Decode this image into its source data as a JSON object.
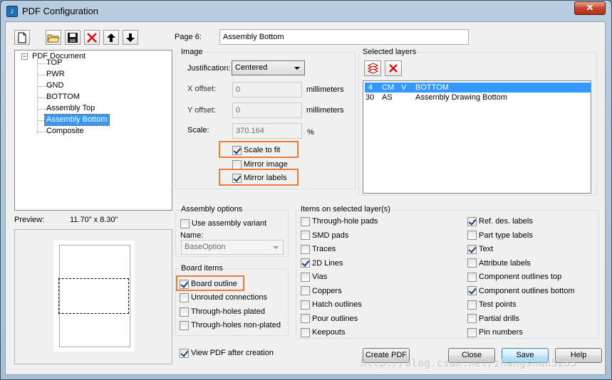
{
  "window": {
    "title": "PDF Configuration",
    "close_glyph": "✕"
  },
  "toolbar": {
    "buttons": [
      {
        "name": "new-icon"
      },
      {
        "name": "open-folder-icon"
      },
      {
        "name": "save-icon"
      },
      {
        "name": "delete-icon"
      },
      {
        "name": "move-up-icon"
      },
      {
        "name": "move-down-icon"
      }
    ]
  },
  "tree": {
    "root": "PDF Document",
    "expander": "−",
    "items": [
      "TOP",
      "PWR",
      "GND",
      "BOTTOM",
      "Assembly Top",
      "Assembly Bottom",
      "Composite"
    ],
    "selected_index": 5
  },
  "page": {
    "label": "Page 6:",
    "value": "Assembly Bottom"
  },
  "image": {
    "group_label": "Image",
    "justification_label": "Justification:",
    "justification_value": "Centered",
    "x_offset_label": "X offset:",
    "x_offset_value": "0",
    "y_offset_label": "Y offset:",
    "y_offset_value": "0",
    "scale_label": "Scale:",
    "scale_value": "370.164",
    "unit_mm": "millimeters",
    "unit_pct": "%",
    "scale_to_fit": {
      "label": "Scale to fit",
      "checked": true
    },
    "mirror_image": {
      "label": "Mirror image",
      "checked": false
    },
    "mirror_labels": {
      "label": "Mirror labels",
      "checked": true
    }
  },
  "selected_layers": {
    "group_label": "Selected layers",
    "rows": [
      {
        "num": "4",
        "type": "CM",
        "flag": "V",
        "name": "BOTTOM"
      },
      {
        "num": "30",
        "type": "AS",
        "flag": "",
        "name": "Assembly Drawing Bottom"
      }
    ],
    "selected_index": 0
  },
  "preview": {
    "label": "Preview:",
    "size": "11.70\" x  8.30\""
  },
  "assembly_options": {
    "group_label": "Assembly options",
    "use_variant": {
      "label": "Use assembly variant",
      "checked": false
    },
    "name_label": "Name:",
    "name_value": "BaseOption"
  },
  "board_items": {
    "group_label": "Board items",
    "items": [
      {
        "label": "Board outline",
        "checked": true
      },
      {
        "label": "Unrouted connections",
        "checked": false
      },
      {
        "label": "Through-holes plated",
        "checked": false
      },
      {
        "label": "Through-holes non-plated",
        "checked": false
      }
    ]
  },
  "items_on_layer": {
    "group_label": "Items on selected layer(s)",
    "left": [
      {
        "label": "Through-hole pads",
        "checked": false
      },
      {
        "label": "SMD pads",
        "checked": false
      },
      {
        "label": "Traces",
        "checked": false
      },
      {
        "label": "2D Lines",
        "checked": true
      },
      {
        "label": "Vias",
        "checked": false
      },
      {
        "label": "Coppers",
        "checked": false
      },
      {
        "label": "Hatch outlines",
        "checked": false
      },
      {
        "label": "Pour outlines",
        "checked": false
      },
      {
        "label": "Keepouts",
        "checked": false
      }
    ],
    "right": [
      {
        "label": "Ref. des. labels",
        "checked": true
      },
      {
        "label": "Part type labels",
        "checked": false
      },
      {
        "label": "Text",
        "checked": true
      },
      {
        "label": "Attribute labels",
        "checked": false
      },
      {
        "label": "Component outlines top",
        "checked": false
      },
      {
        "label": "Component outlines bottom",
        "checked": true
      },
      {
        "label": "Test points",
        "checked": false
      },
      {
        "label": "Partial drills",
        "checked": false
      },
      {
        "label": "Pin numbers",
        "checked": false
      }
    ]
  },
  "view_pdf": {
    "label": "View PDF after creation",
    "checked": true
  },
  "buttons": {
    "create_pdf": "Create PDF",
    "close": "Close",
    "save": "Save",
    "help": "Help"
  },
  "watermark": "http://blog.csdn.net/zhangshun5233"
}
